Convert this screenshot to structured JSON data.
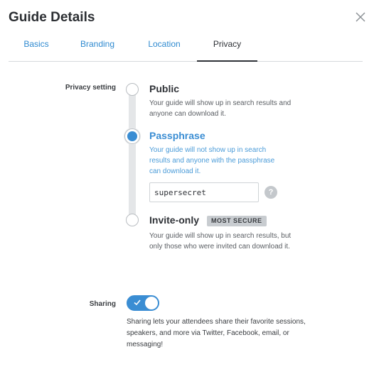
{
  "header": {
    "title": "Guide Details",
    "close_icon": "close-icon"
  },
  "tabs": [
    {
      "label": "Basics",
      "active": false
    },
    {
      "label": "Branding",
      "active": false
    },
    {
      "label": "Location",
      "active": false
    },
    {
      "label": "Privacy",
      "active": true
    }
  ],
  "privacy": {
    "label": "Privacy setting",
    "selected": "passphrase",
    "options": {
      "public": {
        "title": "Public",
        "description": "Your guide will show up in search results and anyone can download it."
      },
      "passphrase": {
        "title": "Passphrase",
        "description": "Your guide will not show up in search results and anyone with the passphrase can download it.",
        "input_value": "supersecret",
        "help_label": "?"
      },
      "invite": {
        "title": "Invite-only",
        "badge": "MOST SECURE",
        "description": "Your guide will show up in search results, but only those who were invited can download it."
      }
    }
  },
  "sharing": {
    "label": "Sharing",
    "enabled": true,
    "description": "Sharing lets your attendees share their favorite sessions, speakers, and more via Twitter, Facebook, email, or messaging!"
  },
  "colors": {
    "accent": "#3a8dd3",
    "tab_link": "#2f8ad0",
    "text": "#2f3237"
  }
}
